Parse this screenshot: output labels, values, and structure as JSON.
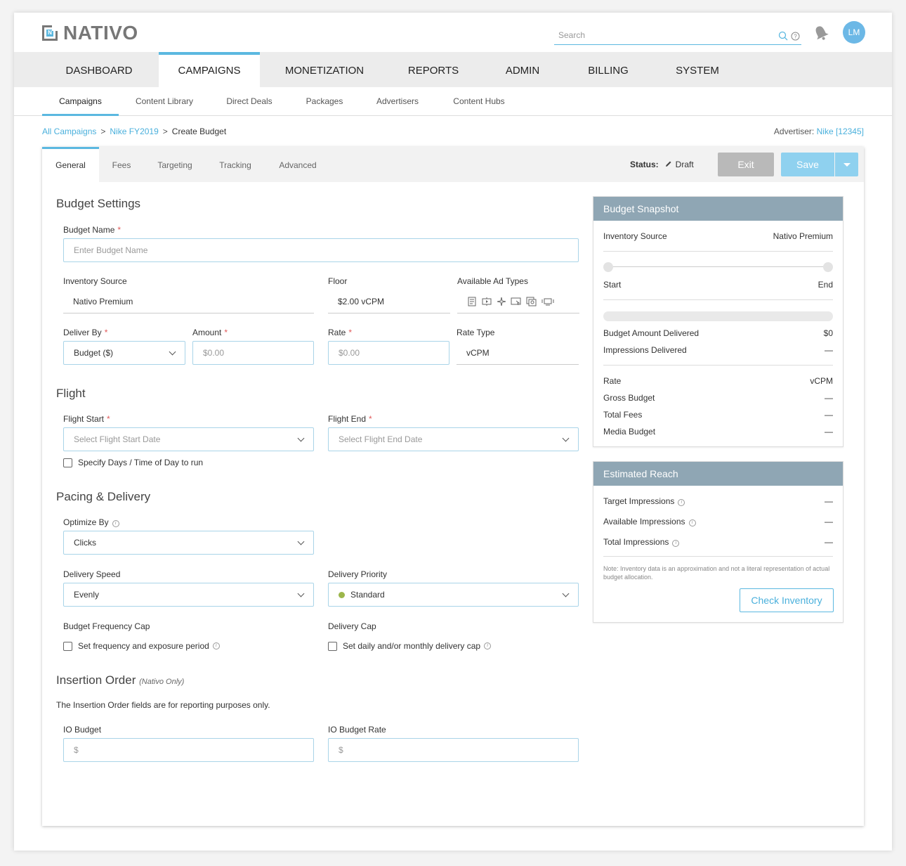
{
  "header": {
    "logo_text": "NATIVO",
    "logo_mark": "N",
    "search_placeholder": "Search",
    "avatar_initials": "LM"
  },
  "main_nav": [
    "DASHBOARD",
    "CAMPAIGNS",
    "MONETIZATION",
    "REPORTS",
    "ADMIN",
    "BILLING",
    "SYSTEM"
  ],
  "sub_nav": [
    "Campaigns",
    "Content Library",
    "Direct Deals",
    "Packages",
    "Advertisers",
    "Content Hubs"
  ],
  "breadcrumb": {
    "item1": "All Campaigns",
    "sep": ">",
    "item2": "Nike FY2019",
    "current": "Create Budget"
  },
  "advertiser": {
    "label": "Advertiser:",
    "value": "Nike [12345]"
  },
  "tabs": [
    "General",
    "Fees",
    "Targeting",
    "Tracking",
    "Advanced"
  ],
  "status": {
    "label": "Status:",
    "value": "Draft"
  },
  "buttons": {
    "exit": "Exit",
    "save": "Save",
    "check_inventory": "Check Inventory"
  },
  "budget_settings": {
    "title": "Budget Settings",
    "budget_name_label": "Budget Name",
    "budget_name_placeholder": "Enter Budget Name",
    "inventory_source_label": "Inventory Source",
    "inventory_source_value": "Nativo Premium",
    "floor_label": "Floor",
    "floor_value": "$2.00 vCPM",
    "ad_types_label": "Available Ad Types",
    "deliver_by_label": "Deliver By",
    "deliver_by_value": "Budget ($)",
    "amount_label": "Amount",
    "amount_placeholder": "$0.00",
    "rate_label": "Rate",
    "rate_placeholder": "$0.00",
    "rate_type_label": "Rate Type",
    "rate_type_value": "vCPM",
    "required_mark": "*"
  },
  "flight": {
    "title": "Flight",
    "start_label": "Flight Start",
    "start_placeholder": "Select Flight Start Date",
    "end_label": "Flight End",
    "end_placeholder": "Select Flight End Date",
    "days_checkbox": "Specify Days / Time of Day to run"
  },
  "pacing": {
    "title": "Pacing & Delivery",
    "optimize_label": "Optimize By",
    "optimize_value": "Clicks",
    "speed_label": "Delivery Speed",
    "speed_value": "Evenly",
    "priority_label": "Delivery Priority",
    "priority_value": "Standard",
    "freq_cap_label": "Budget Frequency Cap",
    "freq_cap_checkbox": "Set frequency and exposure period",
    "delivery_cap_label": "Delivery Cap",
    "delivery_cap_checkbox": "Set daily and/or monthly delivery cap"
  },
  "insertion_order": {
    "title": "Insertion Order",
    "subtitle": "(Nativo Only)",
    "description": "The Insertion Order fields are for reporting purposes only.",
    "io_budget_label": "IO Budget",
    "io_budget_placeholder": "$",
    "io_rate_label": "IO Budget Rate",
    "io_rate_placeholder": "$"
  },
  "snapshot": {
    "title": "Budget Snapshot",
    "inventory_label": "Inventory Source",
    "inventory_value": "Nativo Premium",
    "start_label": "Start",
    "end_label": "End",
    "amount_delivered_label": "Budget Amount Delivered",
    "amount_delivered_value": "$0",
    "impressions_label": "Impressions Delivered",
    "impressions_value": "—",
    "rate_label": "Rate",
    "rate_value": "vCPM",
    "gross_label": "Gross Budget",
    "gross_value": "—",
    "fees_label": "Total Fees",
    "fees_value": "—",
    "media_label": "Media Budget",
    "media_value": "—",
    "delivery_progress": 0
  },
  "reach": {
    "title": "Estimated Reach",
    "target_label": "Target Impressions",
    "target_value": "—",
    "available_label": "Available Impressions",
    "available_value": "—",
    "total_label": "Total Impressions",
    "total_value": "—",
    "note": "Note: Inventory data is an approximation and not a literal representation of actual budget allocation."
  },
  "icons": {
    "info": "i",
    "accent": "#5bb8e0",
    "priority_dot": "#9cb64b"
  }
}
